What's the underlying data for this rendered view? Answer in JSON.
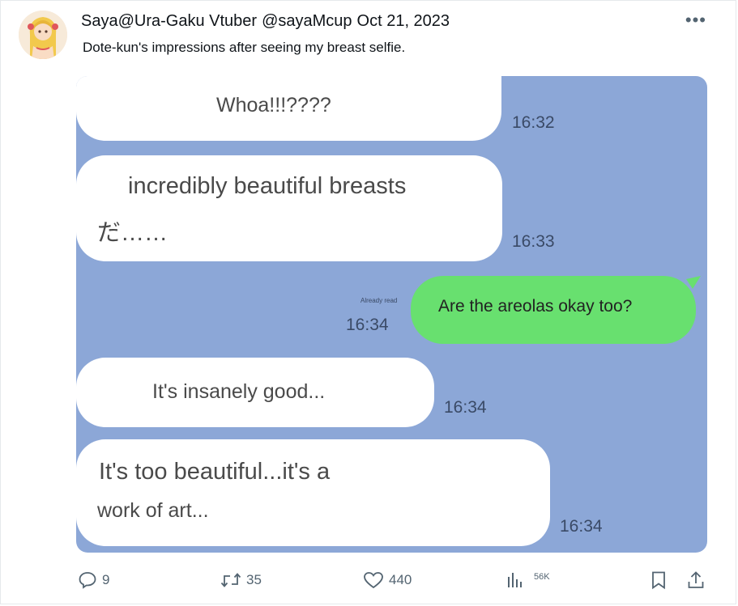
{
  "tweet": {
    "display_name": "Saya@Ura-Gaku Vtuber",
    "handle": "@sayaMcup",
    "date": "Oct 21, 2023",
    "text": "Dote-kun's impressions after seeing my breast selfie."
  },
  "chat": {
    "messages": [
      {
        "side": "in",
        "text_lines": [
          "Whoa!!!????"
        ],
        "time": "16:32"
      },
      {
        "side": "in",
        "text_lines": [
          "incredibly beautiful breasts",
          "だ……"
        ],
        "time": "16:33"
      },
      {
        "side": "out",
        "text_lines": [
          "Are the areolas okay too?"
        ],
        "time": "16:34",
        "read_label": "Already read"
      },
      {
        "side": "in",
        "text_lines": [
          "It's insanely good..."
        ],
        "time": "16:34"
      },
      {
        "side": "in",
        "text_lines": [
          "It's too beautiful...it's a",
          "work of art..."
        ],
        "time": "16:34"
      }
    ]
  },
  "actions": {
    "replies": "9",
    "retweets": "35",
    "likes": "440",
    "views": "56K"
  },
  "colors": {
    "chat_background": "#8ca7d7",
    "incoming_bubble": "#ffffff",
    "outgoing_bubble": "#68e06f",
    "icon_gray": "#536471"
  },
  "icons": [
    "avatar",
    "more-icon",
    "reply-icon",
    "retweet-icon",
    "like-icon",
    "views-icon",
    "bookmark-icon",
    "share-icon"
  ]
}
